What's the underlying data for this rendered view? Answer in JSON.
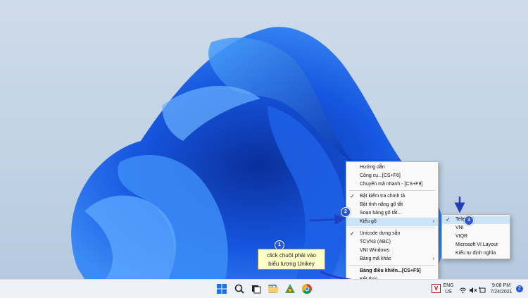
{
  "main_menu": {
    "items": [
      {
        "label": "Hướng dẫn",
        "checked": false,
        "bold": false,
        "submenu": false,
        "sep_before": false
      },
      {
        "label": "Công cụ...[CS+F6]",
        "checked": false,
        "bold": false,
        "submenu": false,
        "sep_before": false
      },
      {
        "label": "Chuyển mã nhanh - [CS+F9]",
        "checked": false,
        "bold": false,
        "submenu": false,
        "sep_before": false
      },
      {
        "label": "Bật kiểm tra chính tả",
        "checked": true,
        "bold": false,
        "submenu": false,
        "sep_before": true
      },
      {
        "label": "Bật tính năng gõ tắt",
        "checked": false,
        "bold": false,
        "submenu": false,
        "sep_before": false
      },
      {
        "label": "Soạn bảng gõ tắt...",
        "checked": false,
        "bold": false,
        "submenu": false,
        "sep_before": false
      },
      {
        "label": "Kiểu gõ",
        "checked": false,
        "bold": false,
        "submenu": true,
        "sep_before": false,
        "highlighted": true
      },
      {
        "label": "Unicode dựng sẵn",
        "checked": true,
        "bold": false,
        "submenu": false,
        "sep_before": true
      },
      {
        "label": "TCVN3 (ABC)",
        "checked": false,
        "bold": false,
        "submenu": false,
        "sep_before": false
      },
      {
        "label": "VNI Windows",
        "checked": false,
        "bold": false,
        "submenu": false,
        "sep_before": false
      },
      {
        "label": "Bảng mã khác",
        "checked": false,
        "bold": false,
        "submenu": true,
        "sep_before": false
      },
      {
        "label": "Bảng điều khiển...[CS+F5]",
        "checked": false,
        "bold": true,
        "submenu": false,
        "sep_before": true
      },
      {
        "label": "Kết thúc",
        "checked": false,
        "bold": false,
        "submenu": false,
        "sep_before": false
      }
    ]
  },
  "sub_menu": {
    "items": [
      {
        "label": "Telex",
        "checked": true
      },
      {
        "label": "VNI",
        "checked": false
      },
      {
        "label": "VIQR",
        "checked": false
      },
      {
        "label": "Microsoft VI Layout",
        "checked": false
      },
      {
        "label": "Kiểu tự định nghĩa",
        "checked": false
      }
    ]
  },
  "callouts": {
    "step1": "1",
    "step2": "2",
    "step3": "3",
    "tooltip_line1": "click chuột phải vào",
    "tooltip_line2": "biểu tượng Unikey"
  },
  "taskbar": {
    "unikey_icon": "V",
    "lang_line1": "ENG",
    "lang_line2": "US",
    "time": "9:08 PM",
    "date": "7/24/2021",
    "notification_count": "2",
    "icons": [
      "windows-start-icon",
      "search-icon",
      "task-view-icon",
      "widgets-icon",
      "file-explorer-icon",
      "app-icon",
      "chrome-icon"
    ]
  },
  "colors": {
    "accent": "#2557d6",
    "menu_highlight": "#cce4f7",
    "tooltip_bg": "#ffffc8",
    "arrow": "#1f3fbf"
  }
}
